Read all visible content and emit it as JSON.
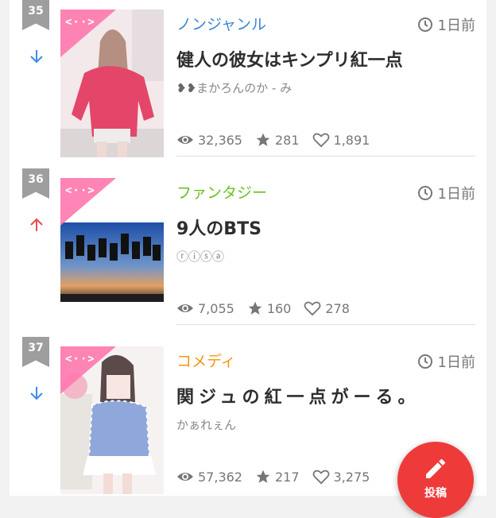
{
  "colors": {
    "accent": "#ef3a3a",
    "down": "#3c8be8",
    "up": "#e84c4c",
    "rank_bg": "#9e9e9e"
  },
  "thumb_corner_label": "<··>",
  "items": [
    {
      "rank": "35",
      "trend": "down",
      "genre": "ノンジャンル",
      "genre_color": "#3a86d8",
      "time": "1日前",
      "title": "健人の彼女はキンプリ紅一点",
      "author": "まかろんのか - み",
      "author_prefix_icon": "hearts-icon",
      "views": "32,365",
      "stars": "281",
      "likes": "1,891"
    },
    {
      "rank": "36",
      "trend": "up",
      "genre": "ファンタジー",
      "genre_color": "#6abf1e",
      "time": "1日前",
      "title": "9人のBTS",
      "author": "ⓡⓘⓢⓐ",
      "views": "7,055",
      "stars": "160",
      "likes": "278"
    },
    {
      "rank": "37",
      "trend": "down",
      "genre": "コメディ",
      "genre_color": "#f0960e",
      "time": "1日前",
      "title": "関ジュの紅一点がーる。",
      "author": "かぁれぇん",
      "views": "57,362",
      "stars": "217",
      "likes": "3,275"
    }
  ],
  "fab": {
    "label": "投稿",
    "icon": "pencil-icon"
  }
}
